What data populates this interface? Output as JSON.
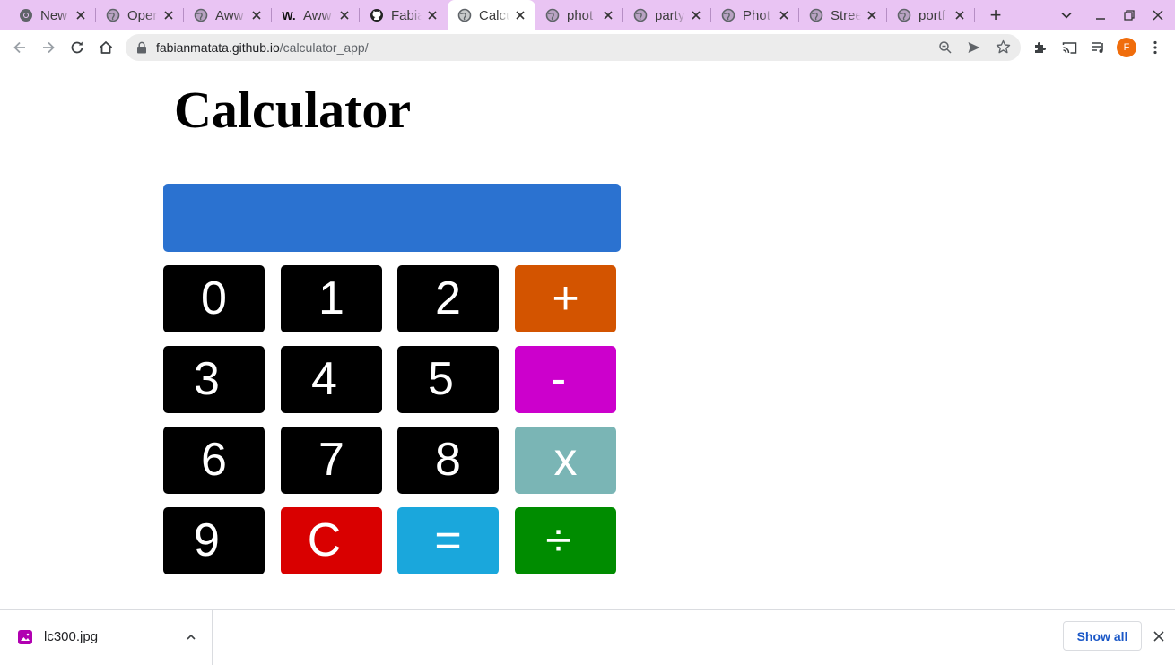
{
  "browser": {
    "tabs": [
      {
        "title": "New",
        "icon": "chrome-icon"
      },
      {
        "title": "Oper",
        "icon": "globe-icon"
      },
      {
        "title": "Aww",
        "icon": "globe-icon"
      },
      {
        "title": "Aww",
        "icon": "w-icon",
        "icon_text": "W."
      },
      {
        "title": "Fabia",
        "icon": "github-icon"
      },
      {
        "title": "Calcu",
        "icon": "globe-icon",
        "active": true
      },
      {
        "title": "phot",
        "icon": "globe-icon"
      },
      {
        "title": "party",
        "icon": "globe-icon"
      },
      {
        "title": "Phot",
        "icon": "globe-icon"
      },
      {
        "title": "Stree",
        "icon": "globe-icon"
      },
      {
        "title": "portf",
        "icon": "globe-icon"
      }
    ],
    "new_tab_label": "+",
    "url_host": "fabianmatata.github.io",
    "url_path": "/calculator_app/",
    "profile_initial": "F"
  },
  "page": {
    "title": "Calculator",
    "display_value": "",
    "display_color": "#2b72d0",
    "keys": [
      {
        "label": "0",
        "color": "#000000"
      },
      {
        "label": "1",
        "color": "#000000"
      },
      {
        "label": "2",
        "color": "#000000"
      },
      {
        "label": "+",
        "color": "#d35400"
      },
      {
        "label": "3",
        "color": "#000000"
      },
      {
        "label": "4",
        "color": "#000000"
      },
      {
        "label": "5",
        "color": "#000000"
      },
      {
        "label": "-",
        "color": "#cc00cc"
      },
      {
        "label": "6",
        "color": "#000000"
      },
      {
        "label": "7",
        "color": "#000000"
      },
      {
        "label": "8",
        "color": "#000000"
      },
      {
        "label": "x",
        "color": "#7ab5b5"
      },
      {
        "label": "9",
        "color": "#000000"
      },
      {
        "label": "C",
        "color": "#d90000"
      },
      {
        "label": "=",
        "color": "#1aa7dc"
      },
      {
        "label": "÷",
        "color": "#008c00"
      }
    ]
  },
  "download_shelf": {
    "file_name": "lc300.jpg",
    "show_all_label": "Show all"
  },
  "colors": {
    "tabstrip": "#e9c4f3",
    "link_blue": "#1a57c7"
  }
}
